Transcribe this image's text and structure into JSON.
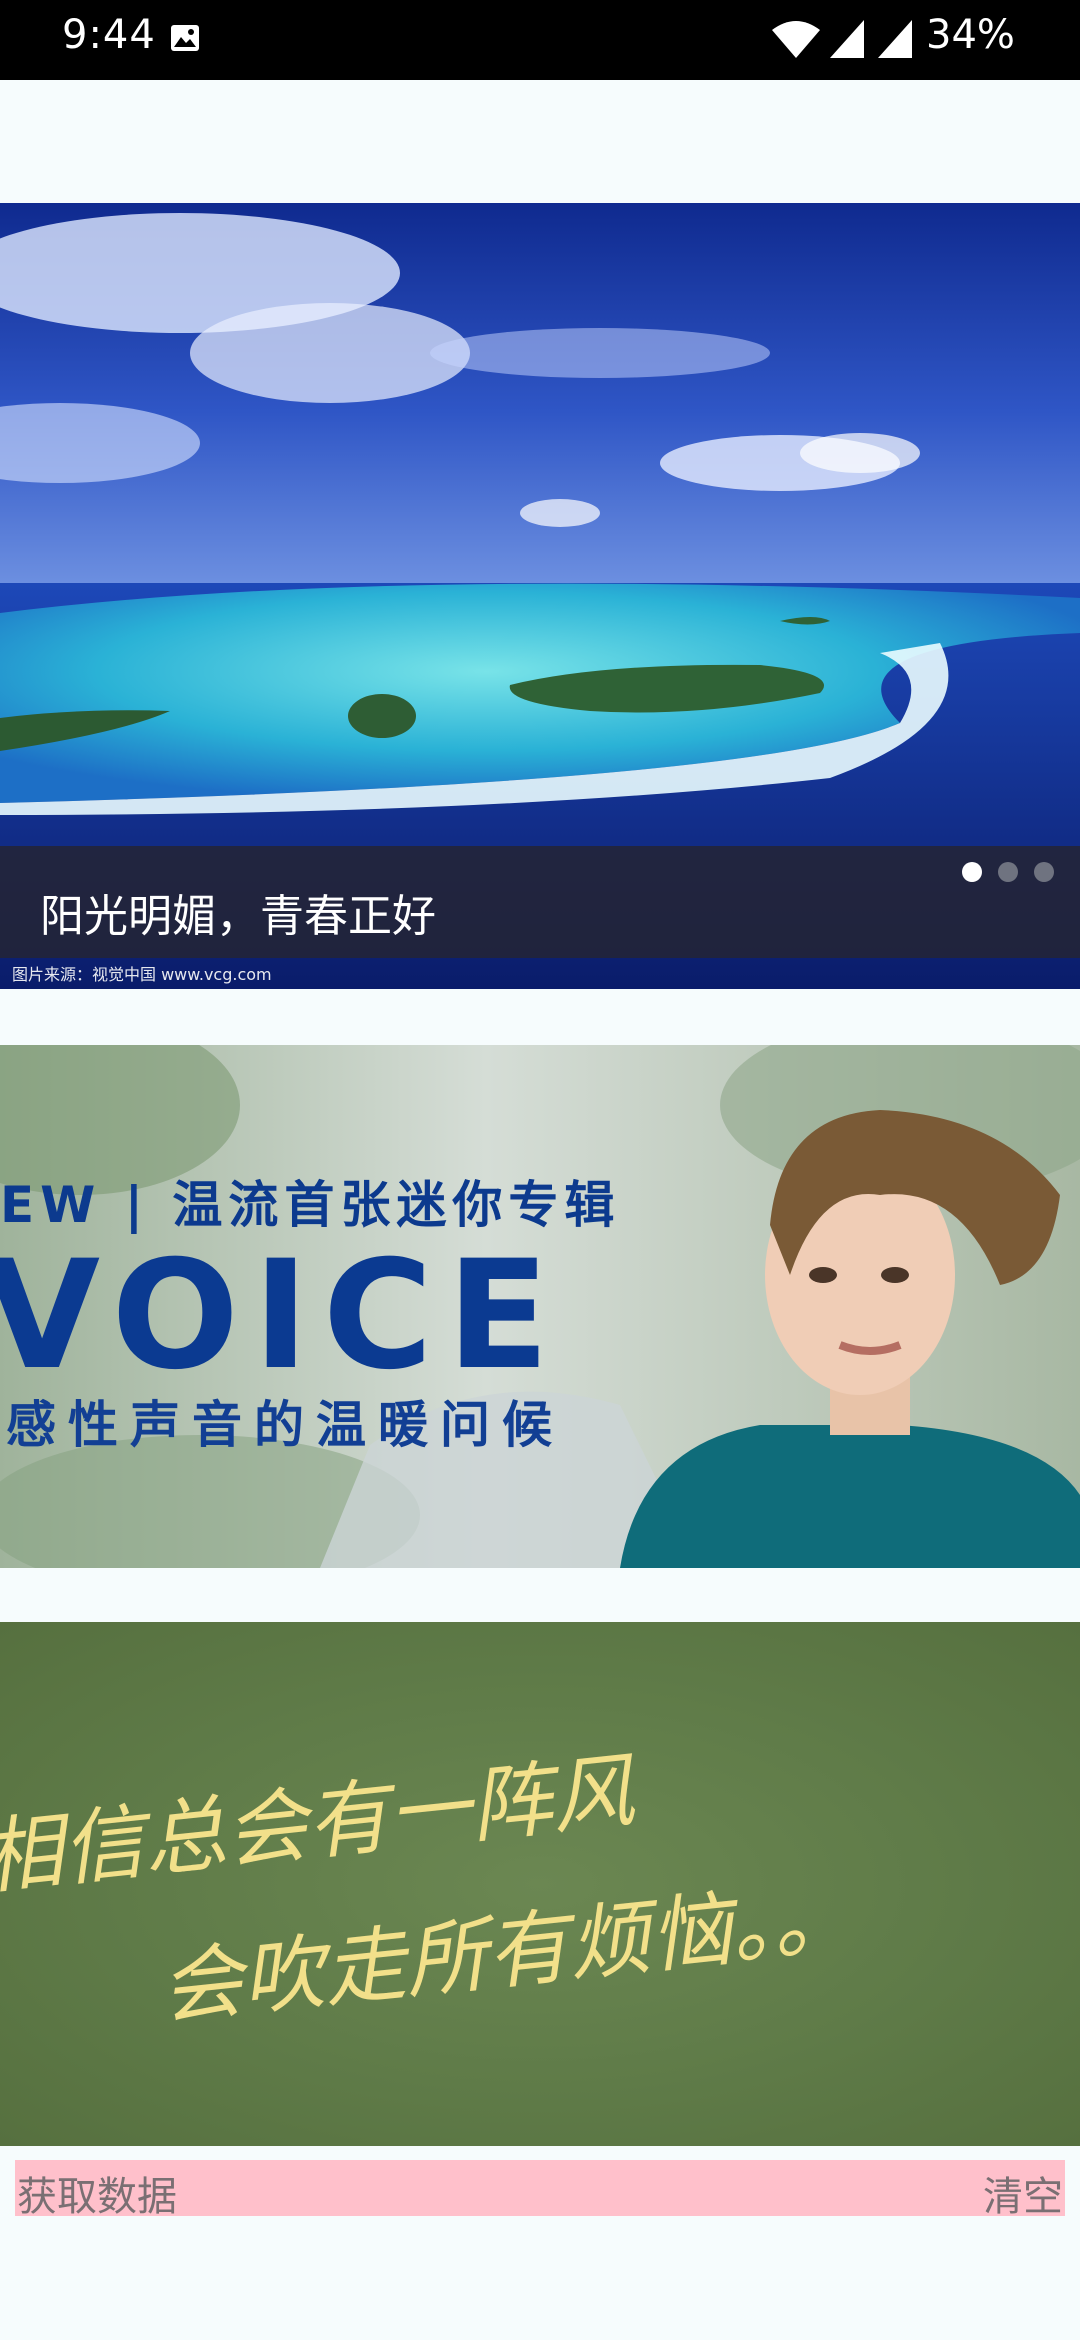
{
  "status_bar": {
    "time": "9:44",
    "battery": "34%",
    "icons": [
      "gallery-icon",
      "wifi-icon",
      "signal-icon",
      "signal-icon"
    ]
  },
  "banners": [
    {
      "caption": "阳光明媚，青春正好",
      "credit": "图片来源：视觉中国 www.vcg.com",
      "dots_total": 3,
      "active_dot": 1
    },
    {
      "header": "EW | 温流首张迷你专辑",
      "title": "VOICE",
      "subtitle": "感性声音的温暖问候"
    },
    {
      "line1": "相信总会有一阵风",
      "line2": "会吹走所有烦恼。。"
    }
  ],
  "actions": {
    "get_data": "获取数据",
    "clear": "清空"
  },
  "colors": {
    "action_bar_bg": "#ffc0cb",
    "page_bg": "#f6fcfd"
  }
}
